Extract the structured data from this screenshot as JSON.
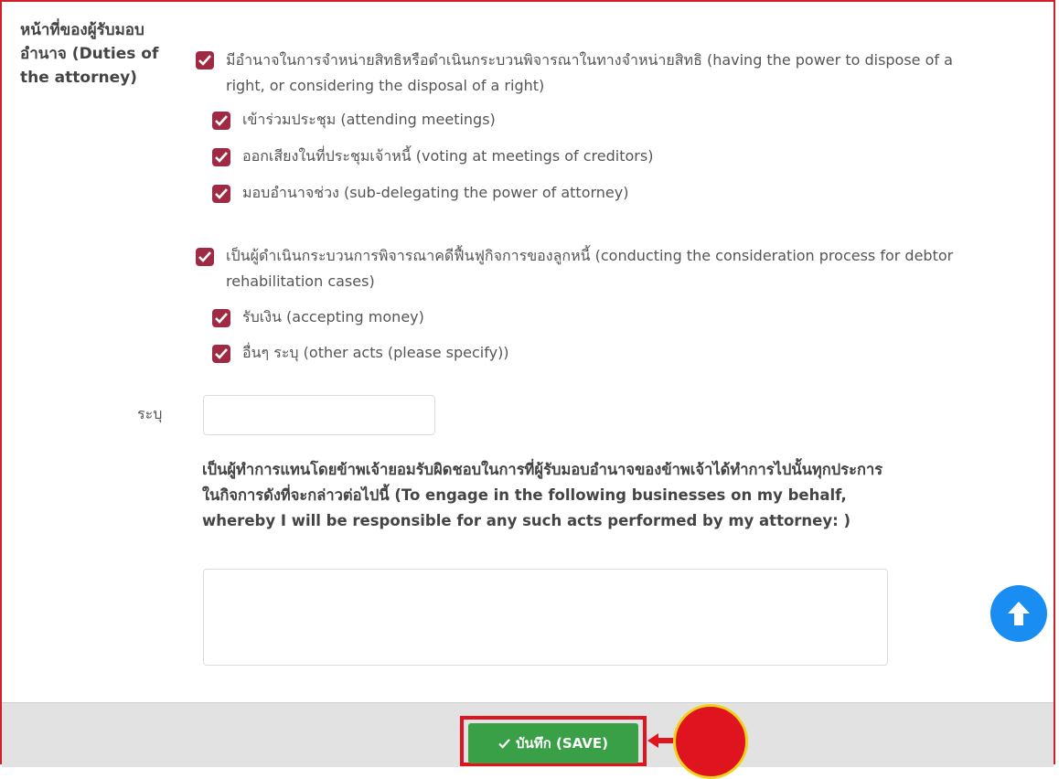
{
  "section": {
    "label": "หน้าที่ของผู้รับมอบอำนาจ (Duties of the attorney)"
  },
  "options": [
    {
      "text": "มีอำนาจในการจำหน่ายสิทธิหรือดำเนินกระบวนพิจารณาในทางจำหน่ายสิทธิ (having the power to dispose of a right, or considering the disposal of a right)",
      "checked": true
    },
    {
      "text": "เข้าร่วมประชุม (attending meetings)",
      "checked": true
    },
    {
      "text": "ออกเสียงในที่ประชุมเจ้าหนี้ (voting at meetings of creditors)",
      "checked": true
    },
    {
      "text": "มอบอำนาจช่วง (sub-delegating the power of attorney)",
      "checked": true
    },
    {
      "text": "เป็นผู้ดำเนินกระบวนการพิจารณาคดีฟื้นฟูกิจการของลูกหนี้ (conducting the consideration process for debtor rehabilitation cases)",
      "checked": true
    },
    {
      "text": "รับเงิน (accepting money)",
      "checked": true
    },
    {
      "text": "อื่นๆ ระบุ (other acts (please specify))",
      "checked": true
    }
  ],
  "specify": {
    "label": "ระบุ",
    "value": ""
  },
  "engage": {
    "text": "เป็นผู้ทำการแทนโดยข้าพเจ้ายอมรับผิดชอบในการที่ผู้รับมอบอำนาจของข้าพเจ้าได้ทำการไปนั้นทุกประการในกิจการดังที่จะกล่าวต่อไปนี้ (To engage in the following businesses on my behalf, whereby I will be responsible for any such acts performed by my attorney: )",
    "value": ""
  },
  "footer": {
    "save_label": "บันทึก (SAVE)"
  },
  "colors": {
    "checkbox": "#9e2b43",
    "save_button": "#3aa047",
    "scroll_top": "#1a8df2",
    "highlight": "#e0141e",
    "marker_border": "#f2d21a"
  },
  "icons": {
    "checkbox": "check-icon",
    "scroll_top": "arrow-up-icon",
    "save": "check-icon",
    "annotation_arrow": "arrow-left-icon"
  }
}
